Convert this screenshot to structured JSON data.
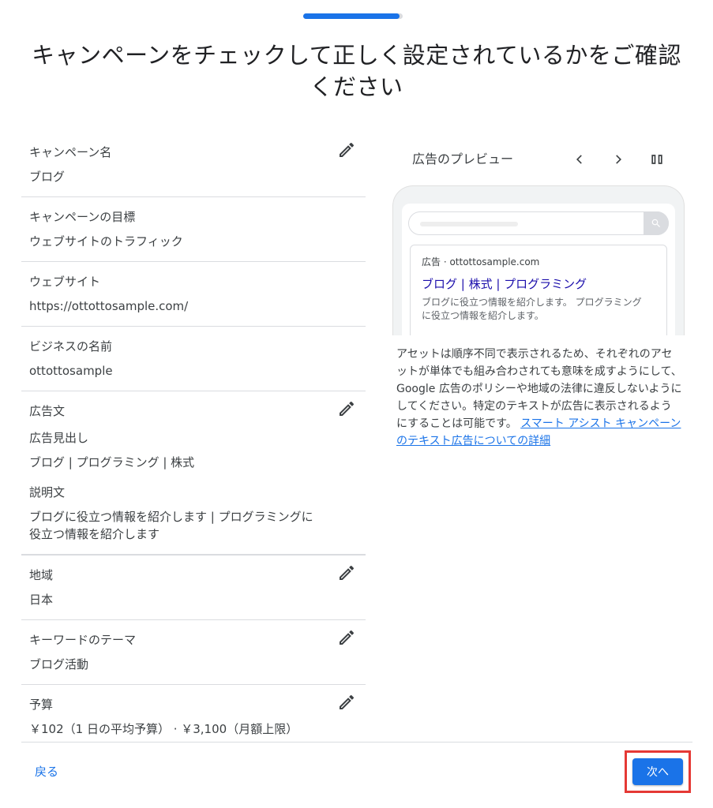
{
  "header": {
    "progress_fraction": 0.97,
    "title_line1": "キャンペーンをチェックして正しく設定されているかをご確認",
    "title_line2": "ください"
  },
  "sections": {
    "campaign_name": {
      "label": "キャンペーン名",
      "value": "ブログ"
    },
    "campaign_goal": {
      "label": "キャンペーンの目標",
      "value": "ウェブサイトのトラフィック"
    },
    "website": {
      "label": "ウェブサイト",
      "value": "https://ottottosample.com/"
    },
    "business_name": {
      "label": "ビジネスの名前",
      "value": "ottottosample"
    },
    "ad_text": {
      "label": "広告文",
      "headline_label": "広告見出し",
      "headline_value": "ブログ | プログラミング | 株式",
      "description_label": "説明文",
      "description_value_line1": "ブログに役立つ情報を紹介します | プログラミングに",
      "description_value_line2": "役立つ情報を紹介します"
    },
    "region": {
      "label": "地域",
      "value": "日本"
    },
    "keyword_theme": {
      "label": "キーワードのテーマ",
      "value": "ブログ活動"
    },
    "budget": {
      "label": "予算",
      "value": "￥102（1 日の平均予算） · ￥3,100（月額上限）"
    }
  },
  "preview": {
    "title": "広告のプレビュー",
    "ad_url": "広告 · ottottosample.com",
    "ad_headline": "ブログ | 株式 | プログラミング",
    "ad_desc_line1": "ブログに役立つ情報を紹介します。 プログラミング",
    "ad_desc_line2": "に役立つ情報を紹介します。"
  },
  "notice": {
    "text": "アセットは順序不同で表示されるため、それぞれのアセットが単体でも組み合わされても意味を成すようにして、Google 広告のポリシーや地域の法律に違反しないようにしてください。特定のテキストが広告に表示されるようにすることは可能です。",
    "link": "スマート アシスト キャンペーンのテキスト広告についての詳細"
  },
  "footer": {
    "back_label": "戻る",
    "next_label": "次へ"
  },
  "colors": {
    "accent": "#1a73e8",
    "highlight_border": "#e53935",
    "ad_headline": "#1a0dab"
  }
}
